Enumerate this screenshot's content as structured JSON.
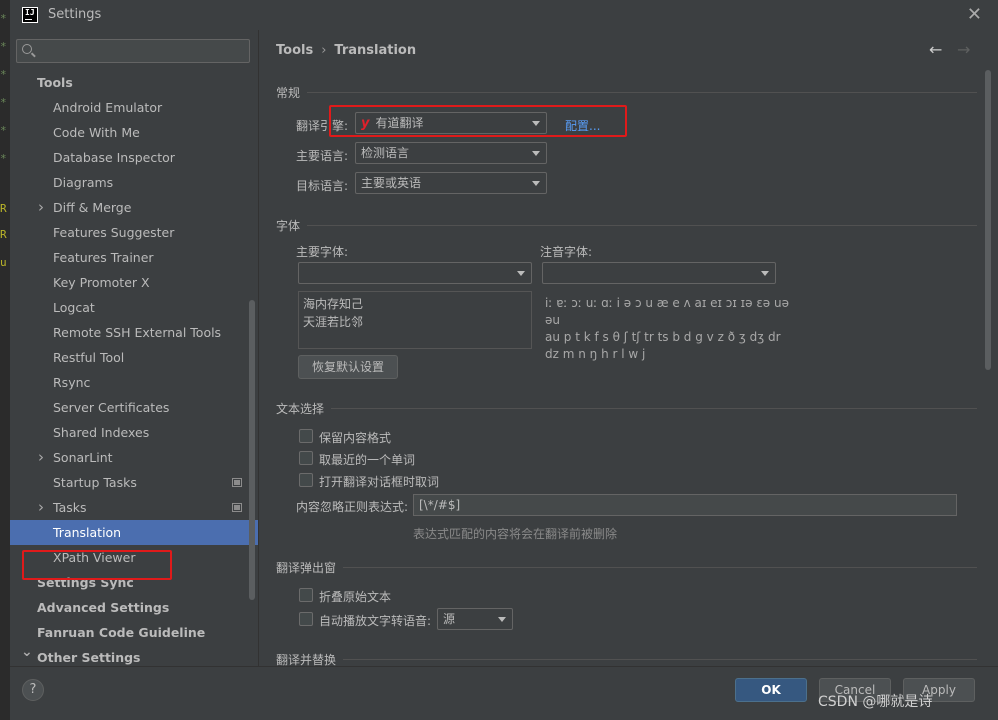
{
  "window": {
    "title": "Settings",
    "app_icon_text": "IJ"
  },
  "gutter": {
    "marks": [
      "*",
      "*",
      "*",
      "*",
      "*",
      "*",
      "R",
      "R",
      "u"
    ]
  },
  "sidebar": {
    "search_placeholder": "",
    "items": [
      {
        "label": "Tools",
        "level": 0,
        "expanded": true
      },
      {
        "label": "Android Emulator",
        "level": 1
      },
      {
        "label": "Code With Me",
        "level": 1
      },
      {
        "label": "Database Inspector",
        "level": 1
      },
      {
        "label": "Diagrams",
        "level": 1
      },
      {
        "label": "Diff & Merge",
        "level": 1,
        "chevron": "right"
      },
      {
        "label": "Features Suggester",
        "level": 1
      },
      {
        "label": "Features Trainer",
        "level": 1
      },
      {
        "label": "Key Promoter X",
        "level": 1
      },
      {
        "label": "Logcat",
        "level": 1
      },
      {
        "label": "Remote SSH External Tools",
        "level": 1
      },
      {
        "label": "Restful Tool",
        "level": 1
      },
      {
        "label": "Rsync",
        "level": 1
      },
      {
        "label": "Server Certificates",
        "level": 1
      },
      {
        "label": "Shared Indexes",
        "level": 1
      },
      {
        "label": "SonarLint",
        "level": 1,
        "chevron": "right"
      },
      {
        "label": "Startup Tasks",
        "level": 1,
        "project_icon": true
      },
      {
        "label": "Tasks",
        "level": 1,
        "chevron": "right",
        "project_icon": true
      },
      {
        "label": "Translation",
        "level": 1,
        "selected": true
      },
      {
        "label": "XPath Viewer",
        "level": 1
      },
      {
        "label": "Settings Sync",
        "level": 0
      },
      {
        "label": "Advanced Settings",
        "level": 0
      },
      {
        "label": "Fanruan Code Guideline",
        "level": 0
      },
      {
        "label": "Other Settings",
        "level": 0,
        "chevron": "down"
      }
    ]
  },
  "breadcrumb": {
    "parent": "Tools",
    "separator": "›",
    "current": "Translation"
  },
  "nav": {
    "back": "←",
    "forward": "→"
  },
  "general": {
    "title": "常规",
    "engine_label": "翻译引擎:",
    "engine_value": "有道翻译",
    "engine_logo": "y",
    "configure_link": "配置...",
    "primary_lang_label": "主要语言:",
    "primary_lang_value": "检测语言",
    "target_lang_label": "目标语言:",
    "target_lang_value": "主要或英语"
  },
  "fonts": {
    "title": "字体",
    "primary_font_label": "主要字体:",
    "primary_font_value": "",
    "phonetic_font_label": "注音字体:",
    "phonetic_font_value": "",
    "preview_line1": "海内存知己",
    "preview_line2": "天涯若比邻",
    "phonetic_line1": "iː ɐː ɔː uː ɑː i ə ɔ u æ e ʌ aɪ eɪ ɔɪ ɪə ɛə uə əu",
    "phonetic_line2": "au p t k f s θ ʃ tʃ tr ts b d g v z ð ʒ dʒ dr",
    "phonetic_line3": "dz m n ŋ h r l w j",
    "restore_button": "恢复默认设置"
  },
  "text_selection": {
    "title": "文本选择",
    "keep_format": "保留内容格式",
    "take_nearest_word": "取最近的一个单词",
    "cancel_on_open": "打开翻译对话框时取词",
    "ignore_regex_label": "内容忽略正则表达式:",
    "ignore_regex_value": "[\\*/#$]",
    "ignore_regex_hint": "表达式匹配的内容将会在翻译前被删除"
  },
  "popup": {
    "title": "翻译弹出窗",
    "fold_original": "折叠原始文本",
    "auto_tts_label": "自动播放文字转语音:",
    "auto_tts_value": "源"
  },
  "replace": {
    "title": "翻译并替换"
  },
  "footer": {
    "help": "?",
    "ok": "OK",
    "cancel": "Cancel",
    "apply": "Apply",
    "watermark": "CSDN @哪就是诗"
  },
  "colors": {
    "background": "#3c3f41",
    "selection": "#4b6eaf",
    "link": "#589df6",
    "highlight_red": "#e01a1a",
    "primary_button": "#365880"
  }
}
